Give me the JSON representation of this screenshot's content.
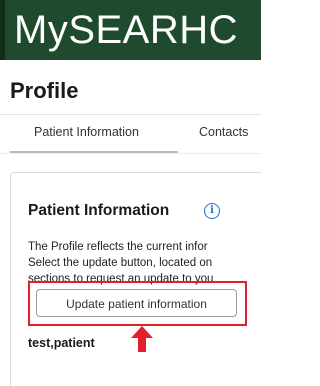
{
  "brand": {
    "title": "MySEARHC",
    "color": "#1f4a2e"
  },
  "page": {
    "title": "Profile"
  },
  "tabs": [
    {
      "label": "Patient Information",
      "active": true
    },
    {
      "label": "Contacts",
      "active": false
    }
  ],
  "section": {
    "title": "Patient Information",
    "info_icon": "info-circle-icon",
    "description_lines": [
      "The Profile reflects the current infor",
      "Select the update button, located on",
      "sections to request an update to you"
    ],
    "update_button_label": "Update patient information",
    "patient_name": "test,patient"
  },
  "annotation": {
    "highlight_color": "#e0202a",
    "arrow_icon": "arrow-up-icon"
  }
}
